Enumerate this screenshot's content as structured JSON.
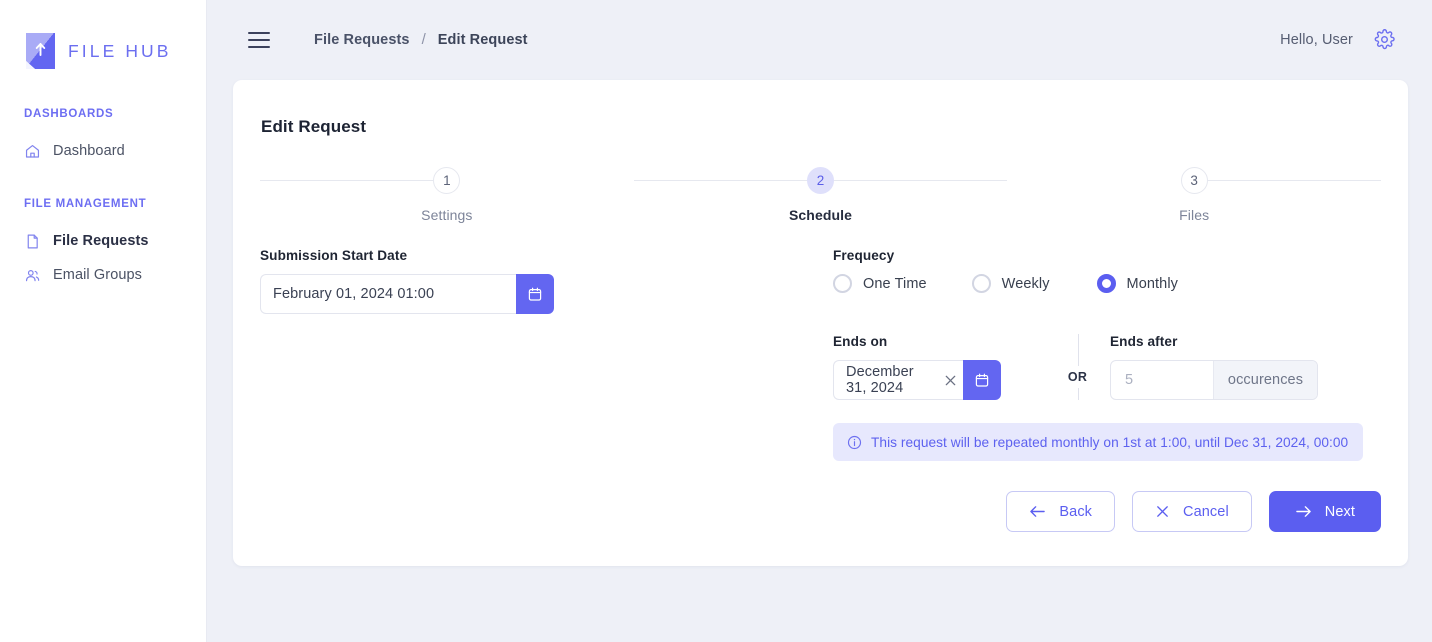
{
  "brand": {
    "name": "FILE HUB",
    "logo_icon": "file-upload-logo"
  },
  "sidebar": {
    "sections": [
      {
        "heading": "DASHBOARDS",
        "items": [
          {
            "label": "Dashboard",
            "icon": "home-icon",
            "active": false
          }
        ]
      },
      {
        "heading": "FILE MANAGEMENT",
        "items": [
          {
            "label": "File Requests",
            "icon": "document-icon",
            "active": true
          },
          {
            "label": "Email Groups",
            "icon": "users-icon",
            "active": false
          }
        ]
      }
    ]
  },
  "topbar": {
    "menu_icon": "hamburger-menu-icon",
    "breadcrumb": [
      {
        "label": "File Requests"
      },
      {
        "label": "Edit Request"
      }
    ],
    "breadcrumb_separator": "/",
    "greeting": "Hello, User",
    "settings_icon": "gear-icon"
  },
  "card": {
    "title": "Edit Request",
    "stepper": [
      {
        "number": "1",
        "label": "Settings",
        "active": false
      },
      {
        "number": "2",
        "label": "Schedule",
        "active": true
      },
      {
        "number": "3",
        "label": "Files",
        "active": false
      }
    ],
    "submission_start": {
      "label": "Submission Start Date",
      "value": "February 01, 2024 01:00",
      "calendar_icon": "calendar-icon"
    },
    "frequency": {
      "label": "Frequecy",
      "options": [
        {
          "label": "One Time",
          "selected": false
        },
        {
          "label": "Weekly",
          "selected": false
        },
        {
          "label": "Monthly",
          "selected": true
        }
      ]
    },
    "ends_on": {
      "label": "Ends on",
      "value": "December 31, 2024",
      "clear_icon": "close-icon",
      "calendar_icon": "calendar-icon"
    },
    "or_label": "OR",
    "ends_after": {
      "label": "Ends after",
      "placeholder": "5",
      "value": "",
      "suffix": "occurences"
    },
    "info": {
      "icon": "info-circle-icon",
      "text": "This request will be repeated monthly on 1st at 1:00, until Dec 31, 2024, 00:00"
    },
    "actions": [
      {
        "label": "Back",
        "icon": "arrow-left-icon",
        "style": "outline"
      },
      {
        "label": "Cancel",
        "icon": "close-icon",
        "style": "outline"
      },
      {
        "label": "Next",
        "icon": "arrow-right-icon",
        "style": "primary"
      }
    ]
  },
  "colors": {
    "accent": "#5b5ef0",
    "accent_light": "#dfe0fb",
    "page_bg": "#eef0f7",
    "card_bg": "#ffffff",
    "info_bg": "#e7e8fd",
    "text_dark": "#1f2533",
    "text_muted": "#7d8499"
  }
}
